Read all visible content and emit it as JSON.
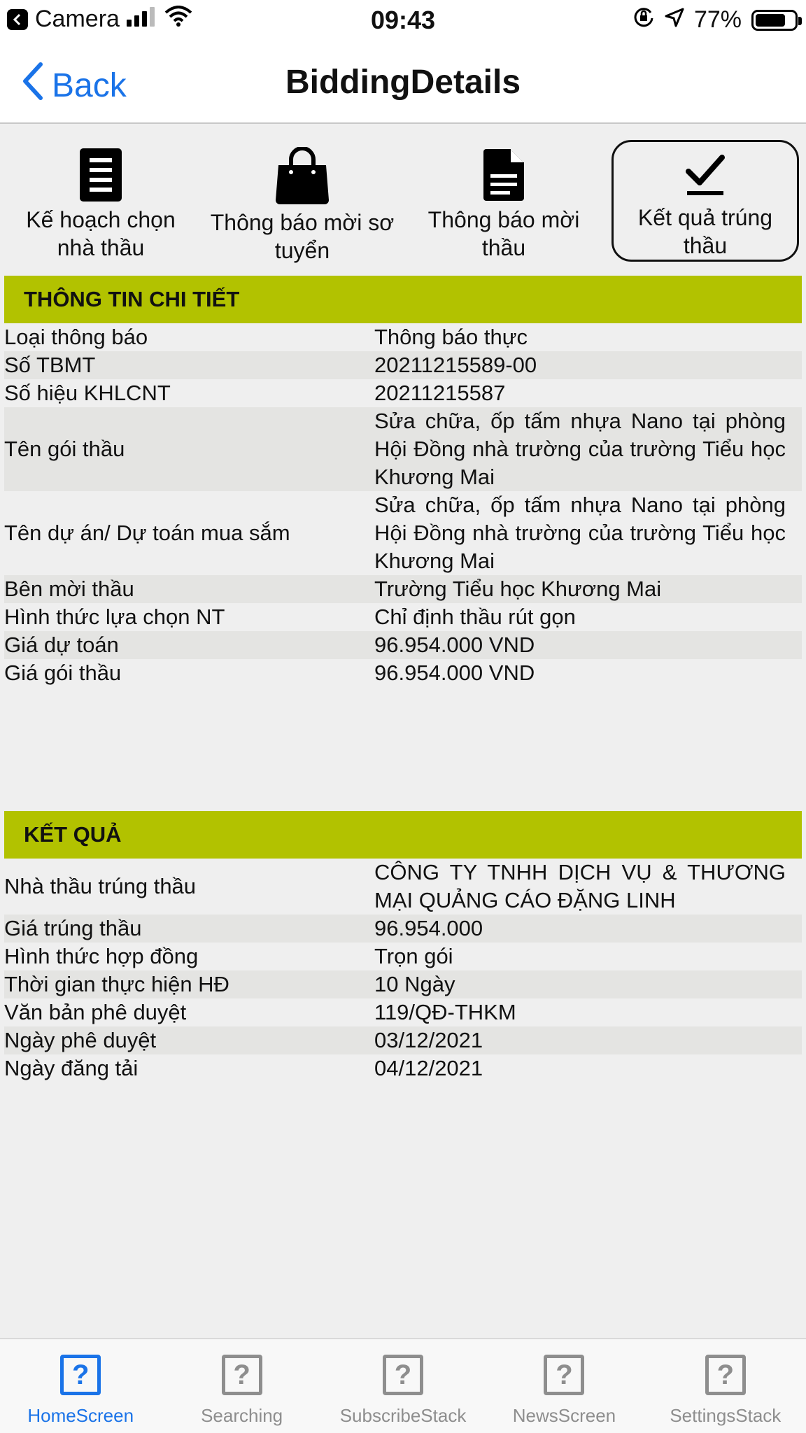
{
  "status_bar": {
    "carrier": "Camera",
    "time": "09:43",
    "battery": "77%",
    "battery_level": 0.77
  },
  "nav": {
    "back_label": "Back",
    "title": "BiddingDetails"
  },
  "tabs": [
    {
      "label": "Kế hoạch chọn nhà thầu",
      "icon": "document-list-icon"
    },
    {
      "label": "Thông báo mời sơ tuyển",
      "icon": "shopping-bag-icon"
    },
    {
      "label": "Thông báo mời thầu",
      "icon": "file-text-icon"
    },
    {
      "label": "Kết quả trúng thầu",
      "icon": "check-underline-icon",
      "active": true
    }
  ],
  "details": {
    "header": "THÔNG TIN CHI TIẾT",
    "rows": [
      {
        "label": "Loại thông báo",
        "value": "Thông báo thực"
      },
      {
        "label": "Số TBMT",
        "value": "20211215589-00"
      },
      {
        "label": "Số hiệu KHLCNT",
        "value": "20211215587"
      },
      {
        "label": "Tên gói thầu",
        "value": "Sửa chữa, ốp tấm nhựa Nano tại phòng Hội Đồng nhà trường của trường Tiểu học Khương Mai"
      },
      {
        "label": "Tên dự án/ Dự toán mua sắm",
        "value": "Sửa chữa, ốp tấm nhựa Nano tại phòng Hội Đồng nhà trường của trường Tiểu học Khương Mai"
      },
      {
        "label": "Bên mời thầu",
        "value": "Trường Tiểu học Khương Mai"
      },
      {
        "label": "Hình thức lựa chọn NT",
        "value": "Chỉ định thầu rút gọn"
      },
      {
        "label": "Giá dự toán",
        "value": "96.954.000 VND"
      },
      {
        "label": "Giá gói thầu",
        "value": "96.954.000  VND"
      }
    ]
  },
  "result": {
    "header": "KẾT QUẢ",
    "rows": [
      {
        "label": "Nhà thầu trúng thầu",
        "value": "CÔNG TY TNHH DỊCH VỤ & THƯƠNG MẠI QUẢNG CÁO ĐẶNG LINH"
      },
      {
        "label": "Giá trúng thầu",
        "value": "96.954.000"
      },
      {
        "label": "Hình thức hợp đồng",
        "value": "Trọn gói"
      },
      {
        "label": "Thời gian thực hiện HĐ",
        "value": "10 Ngày"
      },
      {
        "label": "Văn bản phê duyệt",
        "value": "119/QĐ-THKM"
      },
      {
        "label": "Ngày phê duyệt",
        "value": "03/12/2021"
      },
      {
        "label": "Ngày đăng tải",
        "value": "04/12/2021"
      }
    ]
  },
  "tabbar": [
    {
      "label": "HomeScreen",
      "active": true
    },
    {
      "label": "Searching"
    },
    {
      "label": "SubscribeStack"
    },
    {
      "label": "NewsScreen"
    },
    {
      "label": "SettingsStack"
    }
  ],
  "colors": {
    "accent": "#1a73e8",
    "section": "#b2c200",
    "alt_row": "#e4e4e2"
  }
}
